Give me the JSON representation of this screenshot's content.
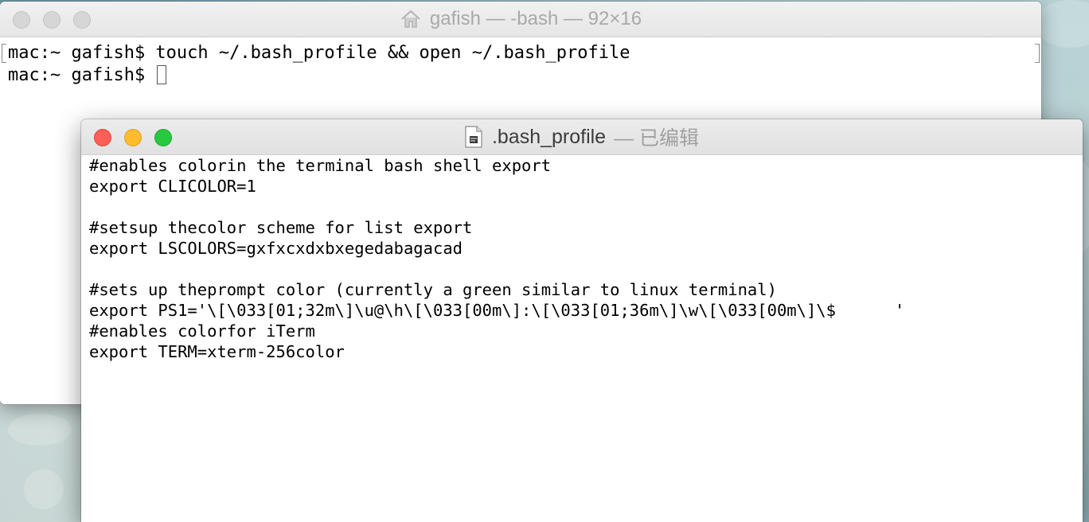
{
  "terminal": {
    "title": "gafish — -bash — 92×16",
    "lines": [
      "mac:~ gafish$ touch ~/.bash_profile && open ~/.bash_profile",
      "mac:~ gafish$ "
    ]
  },
  "editor": {
    "filename": ".bash_profile",
    "status": "— 已编辑",
    "lines": [
      "#enables colorin the terminal bash shell export",
      "export CLICOLOR=1",
      "",
      "#setsup thecolor scheme for list export",
      "export LSCOLORS=gxfxcxdxbxegedabagacad",
      "",
      "#sets up theprompt color (currently a green similar to linux terminal)",
      "export PS1='\\[\\033[01;32m\\]\\u@\\h\\[\\033[00m\\]:\\[\\033[01;36m\\]\\w\\[\\033[00m\\]\\$      '",
      "#enables colorfor iTerm",
      "export TERM=xterm-256color"
    ]
  },
  "icons": {
    "terminal_title_icon": "home-icon",
    "editor_title_icon": "document-icon"
  },
  "colors": {
    "close": "#fe5f57",
    "minimize": "#febc2e",
    "zoom": "#28c840",
    "inactive": "#d6d6d6"
  }
}
